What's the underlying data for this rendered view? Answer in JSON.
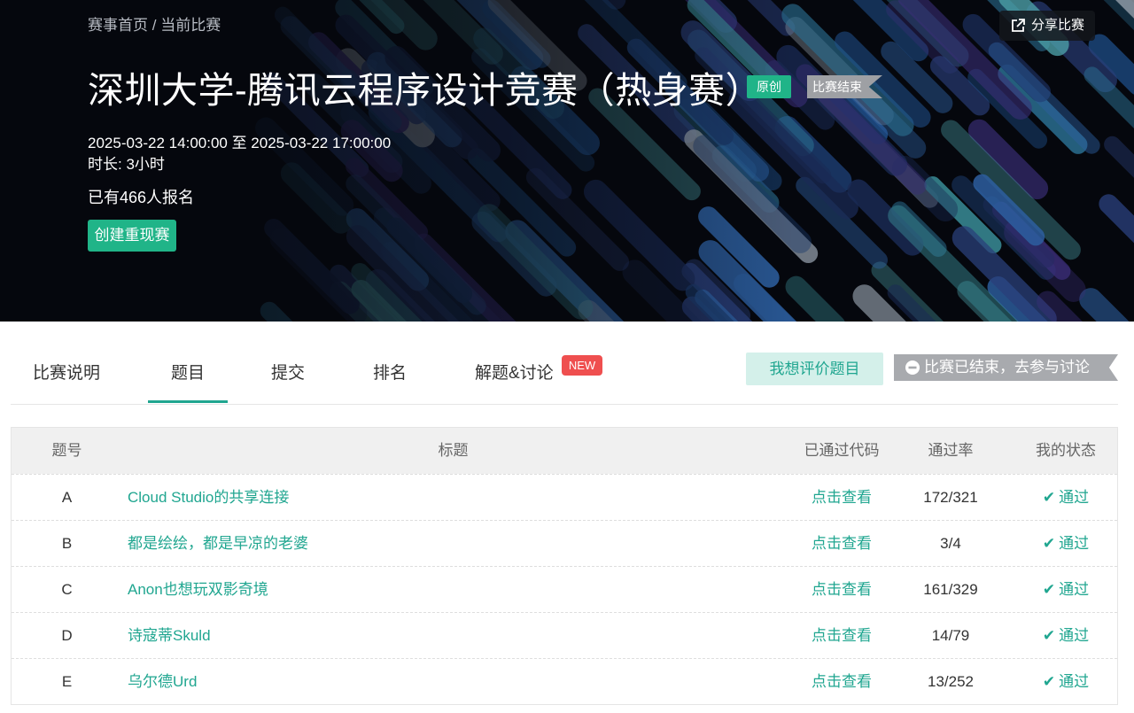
{
  "breadcrumb": {
    "home": "赛事首页",
    "sep": "/",
    "current": "当前比赛"
  },
  "contest": {
    "title": "深圳大学-腾讯云程序设计竞赛（热身赛）",
    "tag_original": "原创",
    "tag_status": "比赛结束",
    "time_range": "2025-03-22 14:00:00 至 2025-03-22 17:00:00",
    "duration": "时长: 3小时",
    "registered": "已有466人报名",
    "create_button": "创建重现赛",
    "share_button": "分享比赛"
  },
  "tabs": [
    {
      "label": "比赛说明"
    },
    {
      "label": "题目"
    },
    {
      "label": "提交"
    },
    {
      "label": "排名"
    },
    {
      "label": "解题&讨论"
    }
  ],
  "new_badge": "NEW",
  "rate_button": "我想评价题目",
  "discuss_button": "比赛已结束，去参与讨论",
  "table": {
    "headers": {
      "id": "题号",
      "title": "标题",
      "code": "已通过代码",
      "rate": "通过率",
      "status": "我的状态"
    },
    "rows": [
      {
        "id": "A",
        "title": "Cloud Studio的共享连接",
        "code": "点击查看",
        "rate": "172/321",
        "status": "通过"
      },
      {
        "id": "B",
        "title": "都是绘绘，都是早凉的老婆",
        "code": "点击查看",
        "rate": "3/4",
        "status": "通过"
      },
      {
        "id": "C",
        "title": "Anon也想玩双影奇境",
        "code": "点击查看",
        "rate": "161/329",
        "status": "通过"
      },
      {
        "id": "D",
        "title": "诗寇蒂Skuld",
        "code": "点击查看",
        "rate": "14/79",
        "status": "通过"
      },
      {
        "id": "E",
        "title": "乌尔德Urd",
        "code": "点击查看",
        "rate": "13/252",
        "status": "通过"
      }
    ]
  },
  "colors": {
    "accent": "#20a690",
    "tag_green": "#20b488",
    "new_red": "#ef4f4f",
    "banner_bg": "#05070d"
  },
  "icons": {
    "share": "share-icon",
    "check": "check-icon",
    "minus": "minus-circle-icon"
  }
}
